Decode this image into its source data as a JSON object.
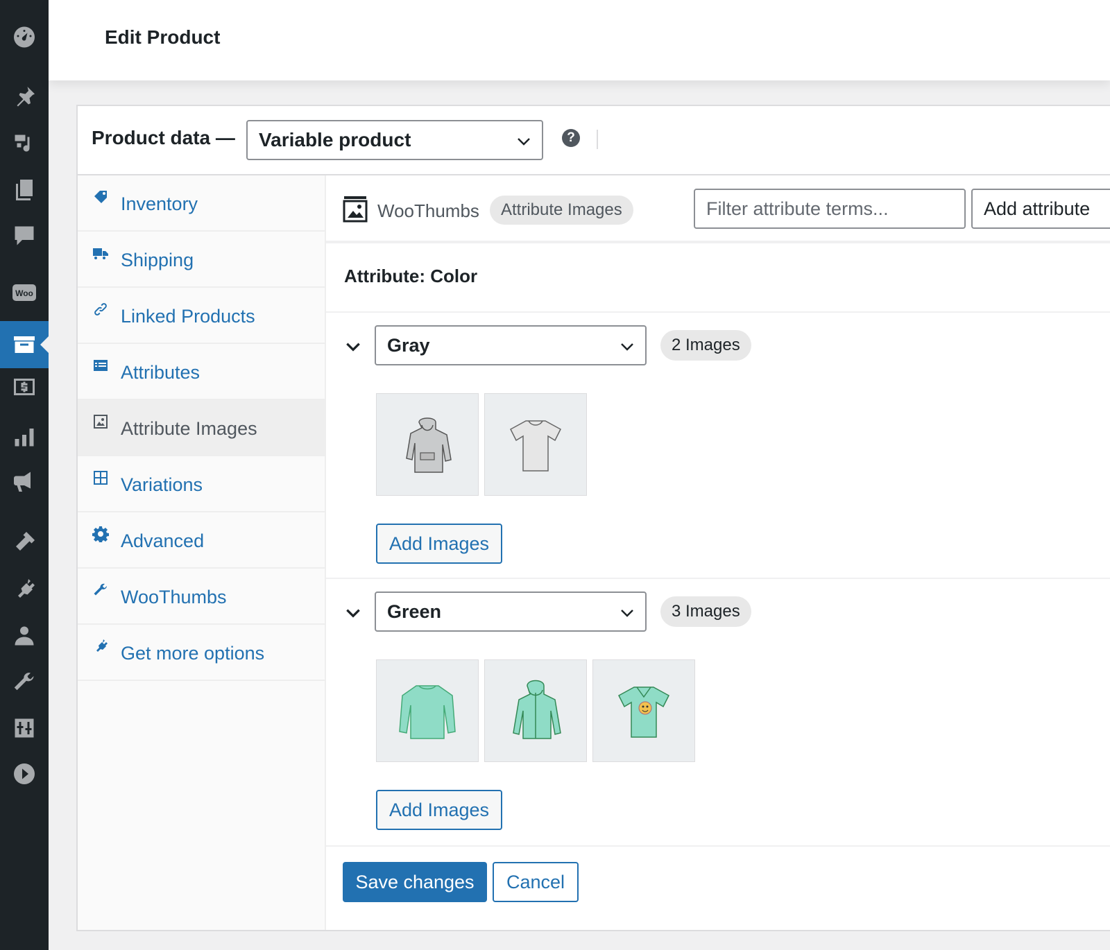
{
  "page": {
    "title": "Edit Product"
  },
  "admin_menu": [
    {
      "icon": "dashboard-icon"
    },
    {
      "icon": "pin-icon"
    },
    {
      "icon": "media-icon"
    },
    {
      "icon": "pages-icon"
    },
    {
      "icon": "comments-icon"
    },
    {
      "icon": "woocommerce-icon",
      "text": "Woo"
    },
    {
      "icon": "products-icon",
      "active": true
    },
    {
      "icon": "payments-icon"
    },
    {
      "icon": "analytics-icon"
    },
    {
      "icon": "marketing-icon"
    },
    {
      "icon": "appearance-icon"
    },
    {
      "icon": "plugins-icon"
    },
    {
      "icon": "users-icon"
    },
    {
      "icon": "tools-icon"
    },
    {
      "icon": "settings-icon"
    },
    {
      "icon": "play-icon"
    }
  ],
  "product_data": {
    "label": "Product data —",
    "type_value": "Variable product",
    "help": "?"
  },
  "tabs": [
    {
      "label": "Inventory",
      "icon": "tag-icon"
    },
    {
      "label": "Shipping",
      "icon": "truck-icon"
    },
    {
      "label": "Linked Products",
      "icon": "link-icon"
    },
    {
      "label": "Attributes",
      "icon": "list-icon"
    },
    {
      "label": "Attribute Images",
      "icon": "image-icon",
      "active": true
    },
    {
      "label": "Variations",
      "icon": "grid-icon"
    },
    {
      "label": "Advanced",
      "icon": "gear-icon"
    },
    {
      "label": "WooThumbs",
      "icon": "wrench-icon"
    },
    {
      "label": "Get more options",
      "icon": "plugin-icon"
    }
  ],
  "toolbar": {
    "brand": "WooThumbs",
    "pill": "Attribute Images",
    "filter_placeholder": "Filter attribute terms...",
    "add_attribute": "Add attribute"
  },
  "attribute": {
    "heading": "Attribute: Color",
    "terms": [
      {
        "value": "Gray",
        "count": "2 Images",
        "add_label": "Add Images",
        "images": [
          {
            "icon": "hoodie-gray-image",
            "color": "#c9cbcc"
          },
          {
            "icon": "tshirt-gray-image",
            "color": "#e6e6e6"
          }
        ]
      },
      {
        "value": "Green",
        "count": "3 Images",
        "add_label": "Add Images",
        "images": [
          {
            "icon": "sweatshirt-green-image",
            "color": "#8fdcc6"
          },
          {
            "icon": "zip-hoodie-green-image",
            "color": "#8fdcc6"
          },
          {
            "icon": "tshirt-green-image",
            "color": "#8fdcc6"
          }
        ]
      }
    ]
  },
  "actions": {
    "save": "Save changes",
    "cancel": "Cancel"
  },
  "colors": {
    "accent": "#2271b1",
    "sidebar": "#1d2327"
  }
}
